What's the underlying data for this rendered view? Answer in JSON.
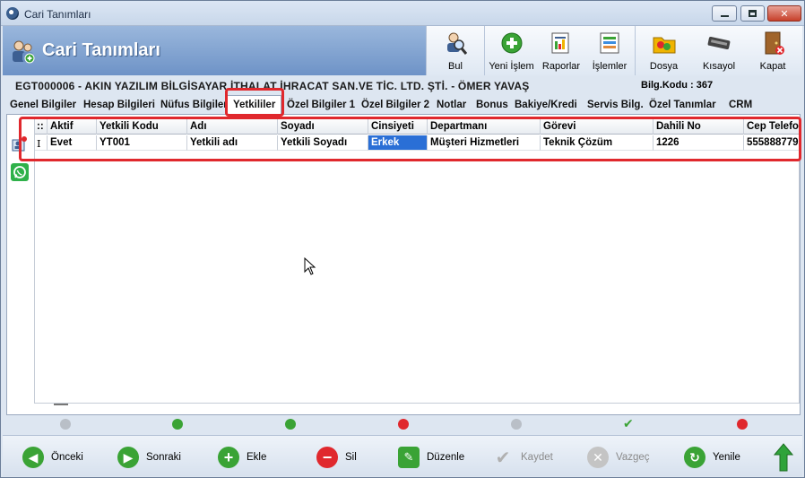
{
  "window": {
    "title": "Cari Tanımları"
  },
  "header": {
    "title": "Cari Tanımları"
  },
  "toolbar": {
    "bul": "Bul",
    "yeni_islem": "Yeni İşlem",
    "raporlar": "Raporlar",
    "islemler": "İşlemler",
    "dosya": "Dosya",
    "kisayol": "Kısayol",
    "kapat": "Kapat"
  },
  "info": {
    "record": "EGT000006  -  AKIN YAZILIM BİLGİSAYAR İTHALAT İHRACAT SAN.VE TİC. LTD. ŞTİ.  -  ÖMER   YAVAŞ",
    "bilg_kodu": "Bilg.Kodu : 367"
  },
  "tabs": [
    "Genel Bilgiler",
    "Hesap Bilgileri",
    "Nüfus Bilgiler",
    "Yetkililer",
    "Özel Bilgiler 1",
    "Özel Bilgiler 2",
    "Notlar",
    "Bonus",
    "Bakiye/Kredi",
    "Servis Bilg.",
    "Özel Tanımlar",
    "CRM"
  ],
  "grid": {
    "columns": [
      "::",
      "Aktif",
      "Yetkili Kodu",
      "Adı",
      "Soyadı",
      "Cinsiyeti",
      "Departmanı",
      "Görevi",
      "Dahili No",
      "Cep Telefo"
    ],
    "rows": [
      [
        "I",
        "Evet",
        "YT001",
        "Yetkili adı",
        "Yetkili Soyadı",
        "Erkek",
        "Müşteri Hizmetleri",
        "Teknik Çözüm",
        "1226",
        "555888779"
      ]
    ]
  },
  "bottom": {
    "onceki": "Önceki",
    "sonraki": "Sonraki",
    "ekle": "Ekle",
    "sil": "Sil",
    "duzenle": "Düzenle",
    "kaydet": "Kaydet",
    "vazgec": "Vazgeç",
    "yenile": "Yenile"
  },
  "colors": {
    "accent_red": "#e0282d",
    "header_blue": "#6e93c7",
    "selection_blue": "#2a6fd6",
    "green": "#3aa335"
  }
}
